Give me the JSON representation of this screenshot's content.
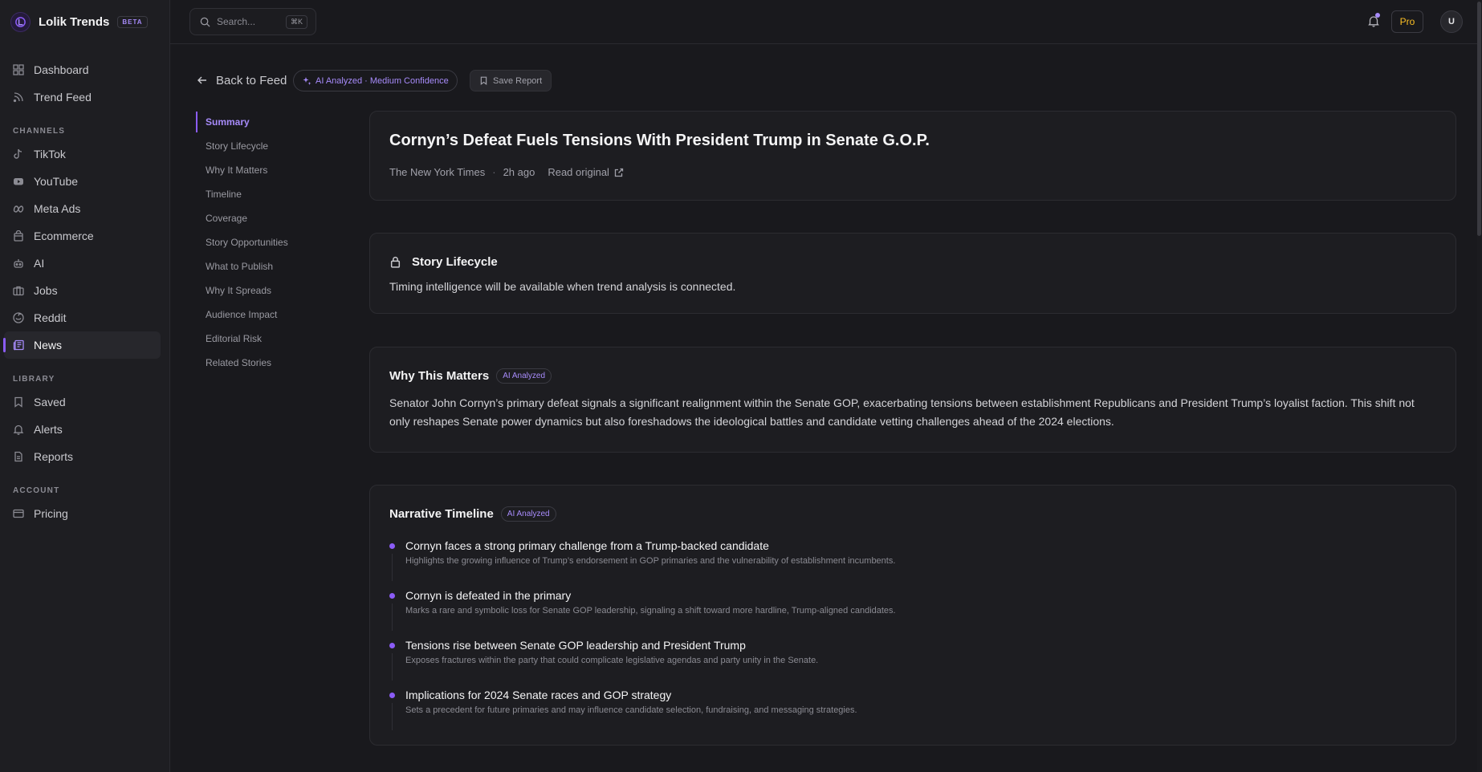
{
  "app": {
    "name": "Lolik Trends",
    "badge": "BETA"
  },
  "sidebar": {
    "top_items": [
      {
        "label": "Dashboard",
        "icon": "grid-icon"
      },
      {
        "label": "Trend Feed",
        "icon": "rss-icon"
      }
    ],
    "channels_label": "CHANNELS",
    "channels": [
      {
        "label": "TikTok",
        "icon": "tiktok-icon"
      },
      {
        "label": "YouTube",
        "icon": "youtube-icon"
      },
      {
        "label": "Meta Ads",
        "icon": "meta-icon"
      },
      {
        "label": "Ecommerce",
        "icon": "shopping-bag-icon"
      },
      {
        "label": "AI",
        "icon": "bot-icon"
      },
      {
        "label": "Jobs",
        "icon": "briefcase-icon"
      },
      {
        "label": "Reddit",
        "icon": "reddit-icon"
      },
      {
        "label": "News",
        "icon": "newspaper-icon",
        "active": true
      }
    ],
    "library_label": "LIBRARY",
    "library": [
      {
        "label": "Saved",
        "icon": "bookmark-icon"
      },
      {
        "label": "Alerts",
        "icon": "bell-icon"
      },
      {
        "label": "Reports",
        "icon": "file-icon"
      }
    ],
    "account_label": "ACCOUNT",
    "account": [
      {
        "label": "Pricing",
        "icon": "credit-card-icon"
      }
    ]
  },
  "header": {
    "search_placeholder": "Search...",
    "search_shortcut": "⌘K",
    "plan_label": "Pro",
    "avatar_initial": "U",
    "notification_dot": true
  },
  "actions": {
    "back_label": "Back to Feed",
    "ai_label": "AI Analyzed · Medium Confidence",
    "save_label": "Save Report"
  },
  "toc": {
    "items": [
      "Summary",
      "Story Lifecycle",
      "Why It Matters",
      "Timeline",
      "Coverage",
      "Story Opportunities",
      "What to Publish",
      "Why It Spreads",
      "Audience Impact",
      "Editorial Risk",
      "Related Stories"
    ],
    "active_index": 0
  },
  "article": {
    "headline": "Cornyn’s Defeat Fuels Tensions With President Trump in Senate G.O.P.",
    "source": "The New York Times",
    "separator": "·",
    "time_ago": "2h ago",
    "read_original": "Read original"
  },
  "lifecycle": {
    "title": "Story Lifecycle",
    "text": "Timing intelligence will be available when trend analysis is connected."
  },
  "why_matters": {
    "title": "Why This Matters",
    "badge": "AI Analyzed",
    "text": "Senator John Cornyn’s primary defeat signals a significant realignment within the Senate GOP, exacerbating tensions between establishment Republicans and President Trump’s loyalist faction. This shift not only reshapes Senate power dynamics but also foreshadows the ideological battles and candidate vetting challenges ahead of the 2024 elections."
  },
  "timeline": {
    "title": "Narrative Timeline",
    "badge": "AI Analyzed",
    "items": [
      {
        "title": "Cornyn faces a strong primary challenge from a Trump-backed candidate",
        "desc": "Highlights the growing influence of Trump’s endorsement in GOP primaries and the vulnerability of establishment incumbents."
      },
      {
        "title": "Cornyn is defeated in the primary",
        "desc": "Marks a rare and symbolic loss for Senate GOP leadership, signaling a shift toward more hardline, Trump-aligned candidates."
      },
      {
        "title": "Tensions rise between Senate GOP leadership and President Trump",
        "desc": "Exposes fractures within the party that could complicate legislative agendas and party unity in the Senate."
      },
      {
        "title": "Implications for 2024 Senate races and GOP strategy",
        "desc": "Sets a precedent for future primaries and may influence candidate selection, fundraising, and messaging strategies."
      }
    ]
  },
  "colors": {
    "accent": "#8b5cf6",
    "accent_text": "#a78bfa",
    "background": "#19191d",
    "card": "#1d1d21",
    "pro": "#fbbf24"
  }
}
